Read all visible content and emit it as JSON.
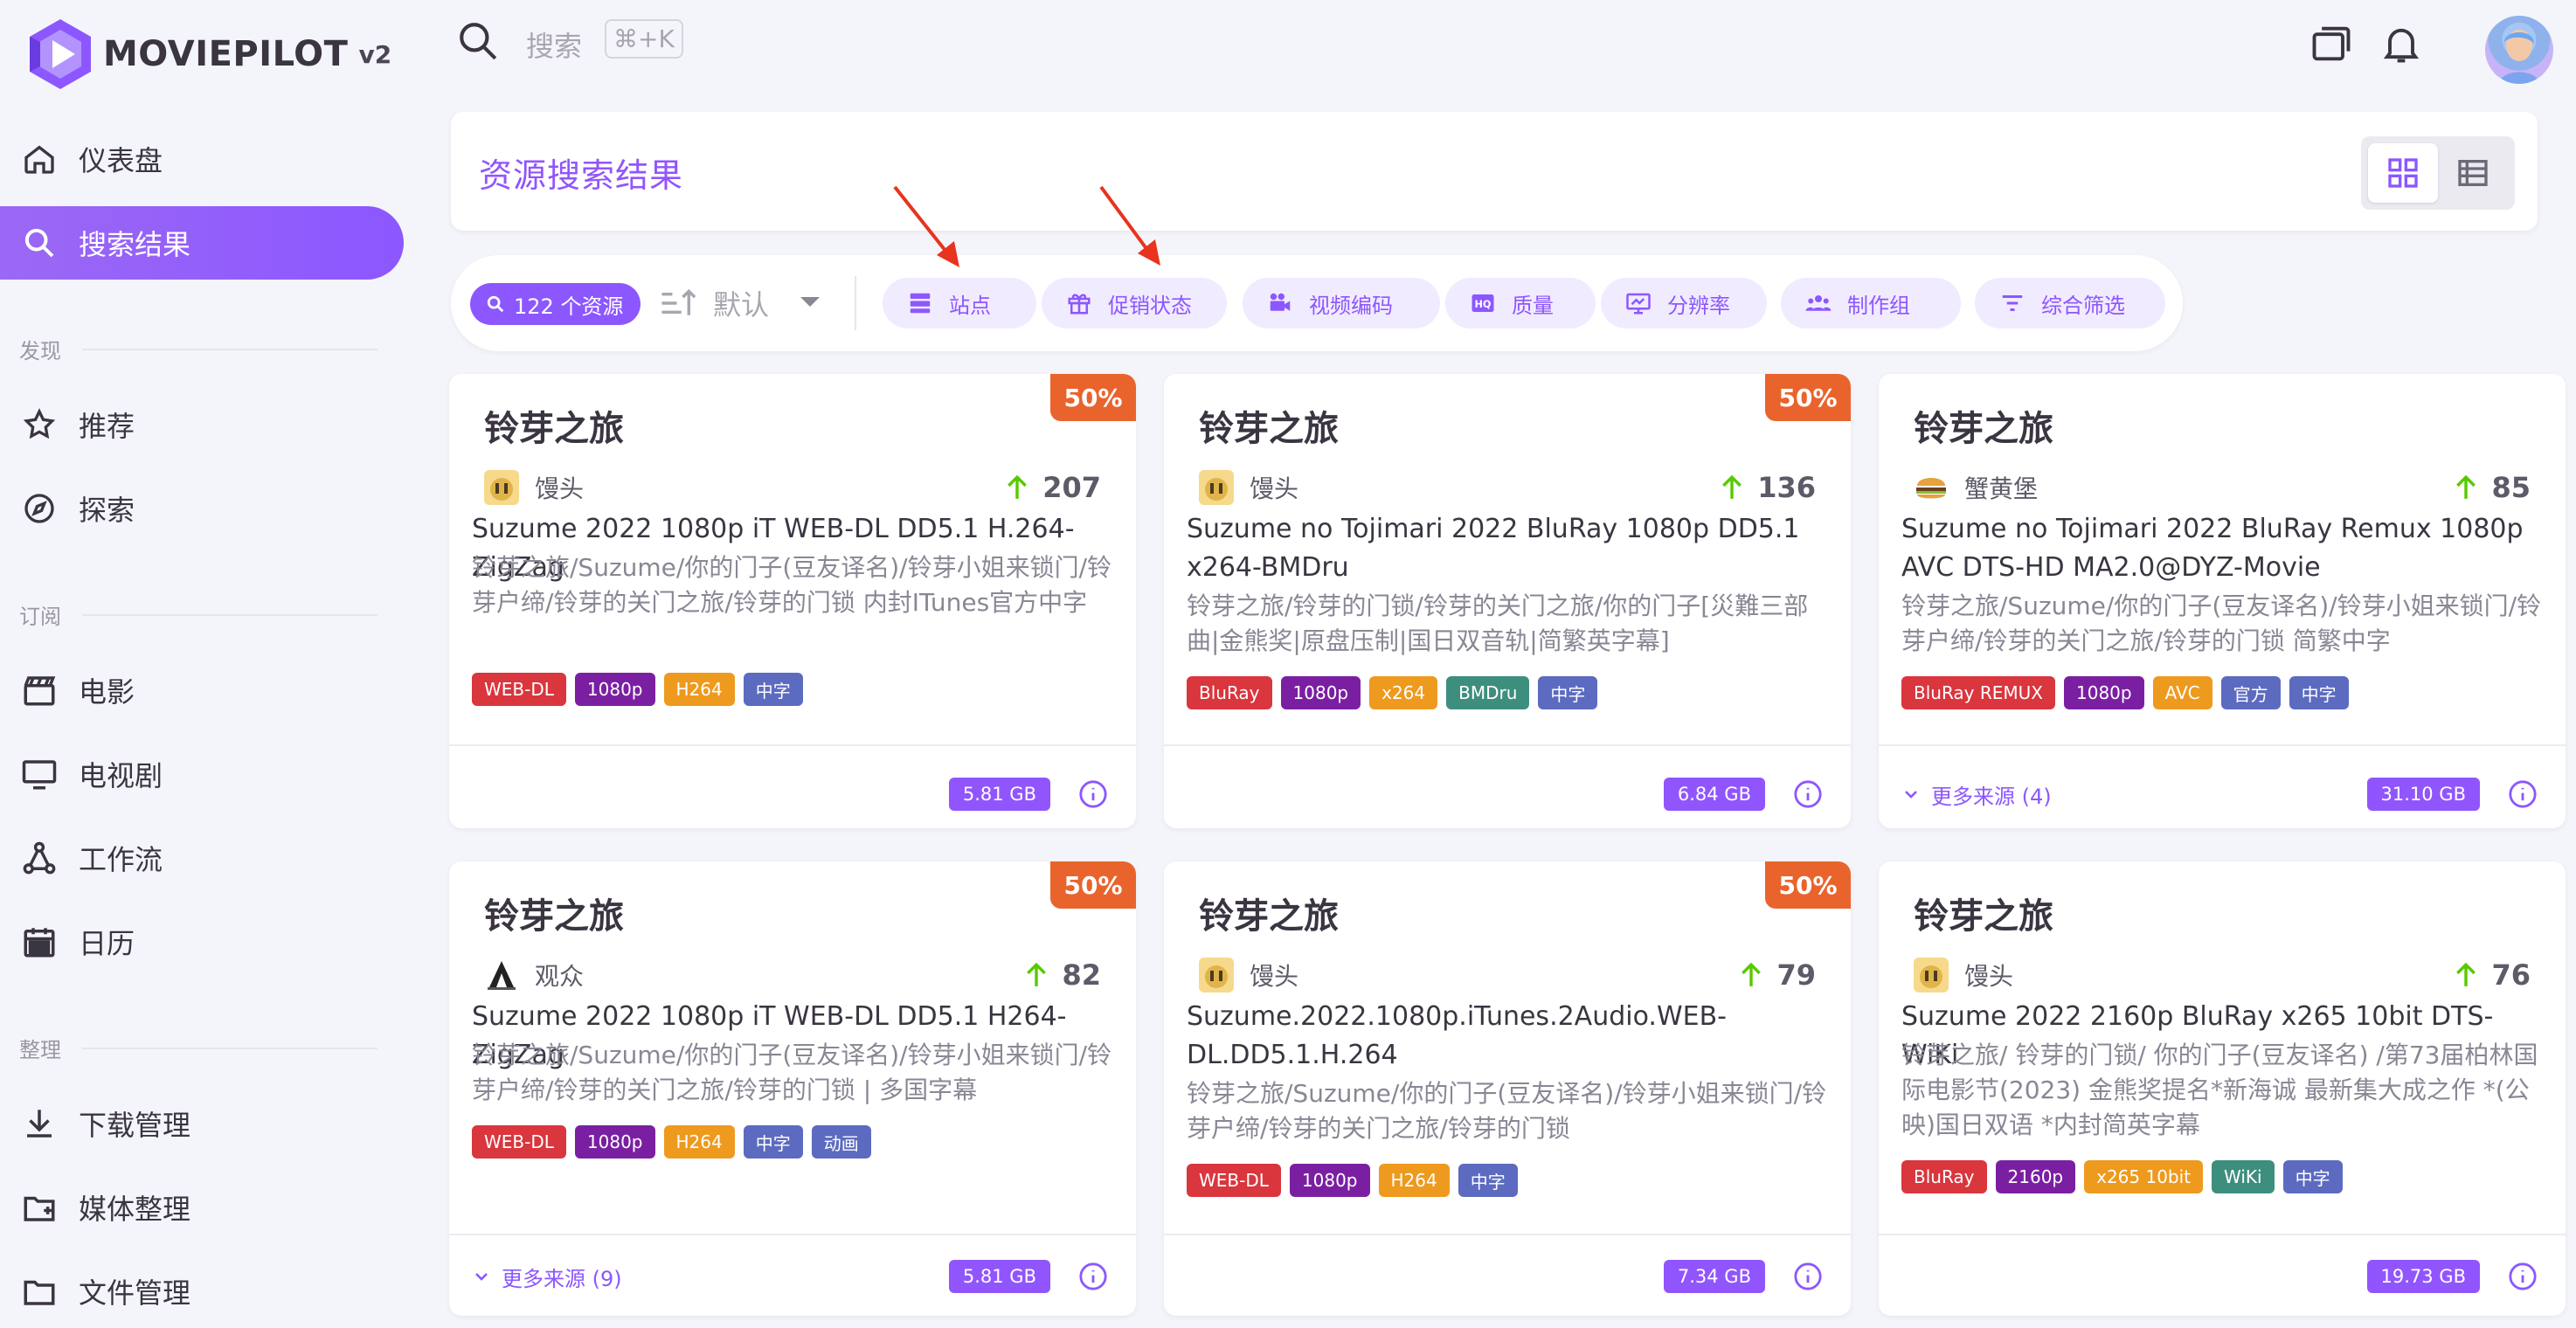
{
  "app": {
    "name": "MOVIEPILOT",
    "version": "v2"
  },
  "colors": {
    "accent": "#8c57ff",
    "promo": "#e9642d",
    "up_arrow": "#56ca00",
    "annotation": "#e8331f"
  },
  "sidebar": {
    "items": [
      {
        "label": "仪表盘",
        "icon": "home-icon"
      },
      {
        "label": "搜索结果",
        "icon": "search-icon",
        "active": true
      },
      {
        "label": "推荐",
        "icon": "star-icon"
      },
      {
        "label": "探索",
        "icon": "compass-icon"
      },
      {
        "label": "电影",
        "icon": "movie-icon"
      },
      {
        "label": "电视剧",
        "icon": "tv-icon"
      },
      {
        "label": "工作流",
        "icon": "workflow-icon"
      },
      {
        "label": "日历",
        "icon": "calendar-icon"
      },
      {
        "label": "下载管理",
        "icon": "download-icon"
      },
      {
        "label": "媒体整理",
        "icon": "folder-icon"
      },
      {
        "label": "文件管理",
        "icon": "folder-icon"
      }
    ],
    "sections": {
      "discover": "发现",
      "subscribe": "订阅",
      "organize": "整理"
    }
  },
  "topbar": {
    "search_placeholder": "搜索",
    "search_shortcut": "⌘+K"
  },
  "header": {
    "title": "资源搜索结果"
  },
  "filters": {
    "count": "122 个资源",
    "sort_label": "默认",
    "chips": [
      "站点",
      "促销状态",
      "视频编码",
      "质量",
      "分辨率",
      "制作组",
      "综合筛选"
    ]
  },
  "cards": [
    {
      "title": "铃芽之旅",
      "promo": "50%",
      "site": "馒头",
      "seeders": "207",
      "name": "Suzume 2022 1080p iT WEB-DL DD5.1 H.264-ZigZag",
      "desc": "铃芽之旅/Suzume/你的门子(豆友译名)/铃芽小姐来锁门/铃芽户缔/铃芽的关门之旅/铃芽的门锁 内封ITunes官方中字",
      "tags": [
        "WEB-DL",
        "1080p",
        "H264",
        "中字"
      ],
      "size": "5.81 GB",
      "more": ""
    },
    {
      "title": "铃芽之旅",
      "promo": "50%",
      "site": "馒头",
      "seeders": "136",
      "name": "Suzume no Tojimari 2022 BluRay 1080p DD5.1 x264-BMDru",
      "desc": "铃芽之旅/铃芽的门锁/铃芽的关门之旅/你的门子[災難三部曲|金熊奖|原盘压制|国日双音轨|简繁英字幕]",
      "tags": [
        "BluRay",
        "1080p",
        "x264",
        "BMDru",
        "中字"
      ],
      "size": "6.84 GB",
      "more": ""
    },
    {
      "title": "铃芽之旅",
      "promo": "",
      "site": "蟹黄堡",
      "seeders": "85",
      "name": "Suzume no Tojimari 2022 BluRay Remux 1080p AVC DTS-HD MA2.0@DYZ-Movie",
      "desc": "铃芽之旅/Suzume/你的门子(豆友译名)/铃芽小姐来锁门/铃芽户缔/铃芽的关门之旅/铃芽的门锁 简繁中字",
      "tags": [
        "BluRay REMUX",
        "1080p",
        "AVC",
        "官方",
        "中字"
      ],
      "size": "31.10 GB",
      "more": "更多来源 (4)"
    },
    {
      "title": "铃芽之旅",
      "promo": "50%",
      "site": "观众",
      "seeders": "82",
      "name": "Suzume 2022 1080p iT WEB-DL DD5.1 H264-ZigZag",
      "desc": "铃芽之旅/Suzume/你的门子(豆友译名)/铃芽小姐来锁门/铃芽户缔/铃芽的关门之旅/铃芽的门锁 | 多国字幕",
      "tags": [
        "WEB-DL",
        "1080p",
        "H264",
        "中字",
        "动画"
      ],
      "size": "5.81 GB",
      "more": "更多来源 (9)"
    },
    {
      "title": "铃芽之旅",
      "promo": "50%",
      "site": "馒头",
      "seeders": "79",
      "name": "Suzume.2022.1080p.iTunes.2Audio.WEB-DL.DD5.1.H.264",
      "desc": "铃芽之旅/Suzume/你的门子(豆友译名)/铃芽小姐来锁门/铃芽户缔/铃芽的关门之旅/铃芽的门锁",
      "tags": [
        "WEB-DL",
        "1080p",
        "H264",
        "中字"
      ],
      "size": "7.34 GB",
      "more": ""
    },
    {
      "title": "铃芽之旅",
      "promo": "",
      "site": "馒头",
      "seeders": "76",
      "name": "Suzume 2022 2160p BluRay x265 10bit DTS-WiKi",
      "desc": "铃芽之旅/ 铃芽的门锁/ 你的门子(豆友译名) /第73届柏林国际电影节(2023) 金熊奖提名*新海诚 最新集大成之作 *(公映)国日双语 *内封简英字幕",
      "tags": [
        "BluRay",
        "2160p",
        "x265 10bit",
        "WiKi",
        "中字"
      ],
      "size": "19.73 GB",
      "more": ""
    }
  ]
}
